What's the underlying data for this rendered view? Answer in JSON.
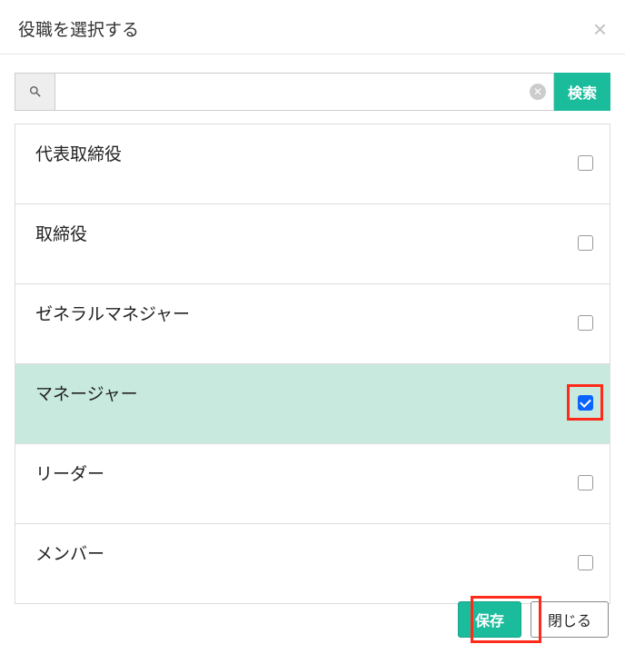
{
  "header": {
    "title": "役職を選択する"
  },
  "search": {
    "button_label": "検索",
    "value": ""
  },
  "items": [
    {
      "label": "代表取締役",
      "checked": false
    },
    {
      "label": "取締役",
      "checked": false
    },
    {
      "label": "ゼネラルマネジャー",
      "checked": false
    },
    {
      "label": "マネージャー",
      "checked": true
    },
    {
      "label": "リーダー",
      "checked": false
    },
    {
      "label": "メンバー",
      "checked": false
    }
  ],
  "footer": {
    "save_label": "保存",
    "close_label": "閉じる"
  }
}
